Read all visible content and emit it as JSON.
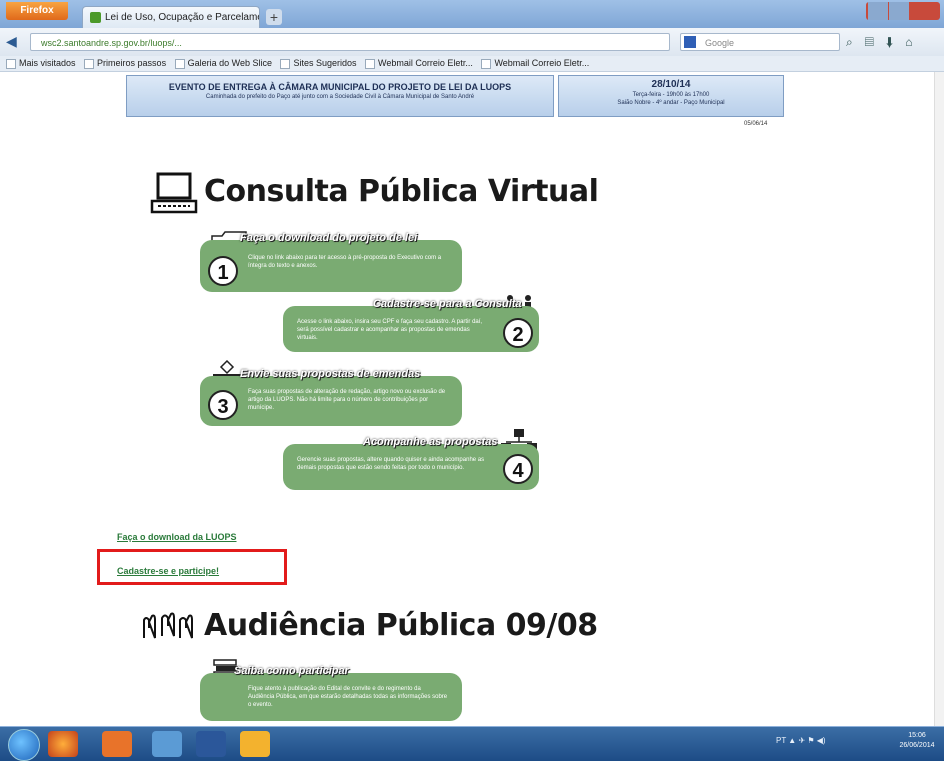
{
  "browser": {
    "button_label": "Firefox",
    "tab_title": "Lei de Uso, Ocupação e Parcelamento d...",
    "new_tab": "+",
    "url": "wsc2.santoandre.sp.gov.br/luops/...",
    "search_placeholder": "Google",
    "bookmarks": [
      "Mais visitados",
      "Primeiros passos",
      "Galeria do Web Slice",
      "Sites Sugeridos",
      "Webmail Correio Eletr...",
      "Webmail Correio Eletr..."
    ]
  },
  "banner": {
    "left_title": "EVENTO DE ENTREGA À CÂMARA MUNICIPAL DO PROJETO DE LEI DA LUOPS",
    "left_subtitle": "Caminhada do prefeito do Paço até junto com a Sociedade Civil à Câmara Municipal de Santo André",
    "right_date": "28/10/14",
    "right_line1": "Terça-feira - 19h00 às 17h00",
    "right_line2": "Saião Nobre - 4º andar - Paço Municipal",
    "stamp": "05/06/14"
  },
  "consulta": {
    "title": "Consulta Pública Virtual",
    "steps": [
      {
        "number": "1",
        "heading": "Faça o download do projeto de lei",
        "body": "Clique no link abaixo para ter acesso à pré-proposta do Executivo com a íntegra do texto e anexos."
      },
      {
        "number": "2",
        "heading": "Cadastre-se para a Consulta",
        "body": "Acesse o link abaixo, insira seu CPF e faça seu cadastro. A partir daí, será possível cadastrar e acompanhar as propostas de emendas virtuais."
      },
      {
        "number": "3",
        "heading": "Envie suas propostas de emendas",
        "body": "Faça suas propostas de alteração de redação, artigo novo ou exclusão de artigo da LUOPS. Não há limite para o número de contribuições por munícipe."
      },
      {
        "number": "4",
        "heading": "Acompanhe as propostas",
        "body": "Gerencie suas propostas, altere quando quiser e ainda acompanhe as demais propostas que estão sendo feitas por todo o município."
      }
    ]
  },
  "links": {
    "download": "Faça o download da LUOPS",
    "register": "Cadastre-se e participe!"
  },
  "audiencia": {
    "title": "Audiência Pública 09/08",
    "step_heading": "Saiba como participar",
    "step_body": "Fique atento à publicação do Edital de convite e do regimento da Audiência Pública, em que estarão detalhadas todas as informações sobre o evento."
  },
  "taskbar": {
    "tray_text": "PT ▲ ✈ ⚑ ◀)",
    "clock_time": "15:06",
    "clock_date": "26/06/2014"
  },
  "colors": {
    "step_green": "#7aab72",
    "link_green": "#2a7a3a",
    "highlight_red": "#e21b1b",
    "banner_blue": "#b8cfea"
  }
}
